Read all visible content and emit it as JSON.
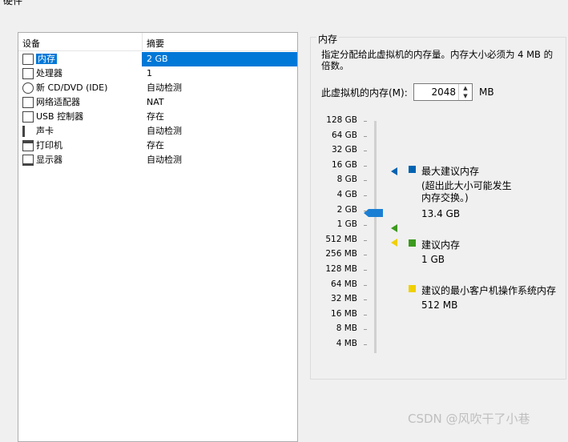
{
  "window": {
    "title": "硬件"
  },
  "devices": {
    "header_device": "设备",
    "header_summary": "摘要",
    "rows": [
      {
        "name": "内存",
        "summary": "2 GB",
        "icon": "memory-icon",
        "selected": true
      },
      {
        "name": "处理器",
        "summary": "1",
        "icon": "processor-icon"
      },
      {
        "name": "新 CD/DVD (IDE)",
        "summary": "自动检测",
        "icon": "cd-dvd-icon"
      },
      {
        "name": "网络适配器",
        "summary": "NAT",
        "icon": "network-adapter-icon"
      },
      {
        "name": "USB 控制器",
        "summary": "存在",
        "icon": "usb-icon"
      },
      {
        "name": "声卡",
        "summary": "自动检测",
        "icon": "speaker-icon"
      },
      {
        "name": "打印机",
        "summary": "存在",
        "icon": "printer-icon"
      },
      {
        "name": "显示器",
        "summary": "自动检测",
        "icon": "monitor-icon"
      }
    ]
  },
  "memory": {
    "group_label": "内存",
    "description": "指定分配给此虚拟机的内存量。内存大小必须为 4 MB 的倍数。",
    "label": "此虚拟机的内存(M):",
    "value": "2048",
    "unit": "MB",
    "scale": [
      "128 GB",
      "64 GB",
      "32 GB",
      "16 GB",
      "8 GB",
      "4 GB",
      "2 GB",
      "1 GB",
      "512 MB",
      "256 MB",
      "128 MB",
      "64 MB",
      "32 MB",
      "16 MB",
      "8 MB",
      "4 MB"
    ],
    "selected_tick": "2 GB",
    "max_recommended": {
      "label": "最大建议内存",
      "note": "(超出此大小可能发生内存交换。)",
      "value": "13.4 GB",
      "color": "#0063b1"
    },
    "recommended": {
      "label": "建议内存",
      "value": "1 GB",
      "color": "#3c9a1e"
    },
    "min_guest": {
      "label": "建议的最小客户机操作系统内存",
      "value": "512 MB",
      "color": "#f0d000"
    }
  },
  "watermark": "CSDN @风吹干了小巷"
}
